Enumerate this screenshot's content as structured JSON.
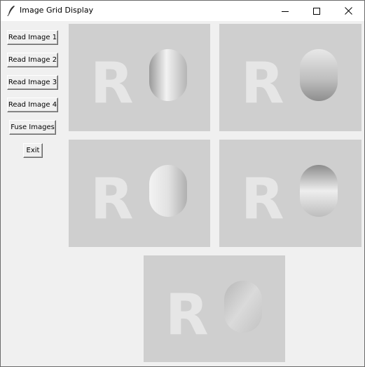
{
  "window": {
    "title": "Image Grid Display",
    "icons": {
      "app": "feather-icon",
      "minimize": "minimize-icon",
      "maximize": "maximize-icon",
      "close": "close-icon"
    }
  },
  "sidebar": {
    "buttons": [
      {
        "label": "Read Image 1"
      },
      {
        "label": "Read Image 2"
      },
      {
        "label": "Read Image 3"
      },
      {
        "label": "Read Image 4"
      },
      {
        "label": "Fuse Images"
      },
      {
        "label": "Exit"
      }
    ]
  },
  "images": [
    {
      "name": "image-1",
      "letter": "R"
    },
    {
      "name": "image-2",
      "letter": "R"
    },
    {
      "name": "image-3",
      "letter": "R"
    },
    {
      "name": "image-4",
      "letter": "R"
    },
    {
      "name": "fused-image",
      "letter": "R"
    }
  ],
  "colors": {
    "panel_bg": "#cfcfcf",
    "letter": "#e8e8e8",
    "window_bg": "#f0f0f0"
  }
}
